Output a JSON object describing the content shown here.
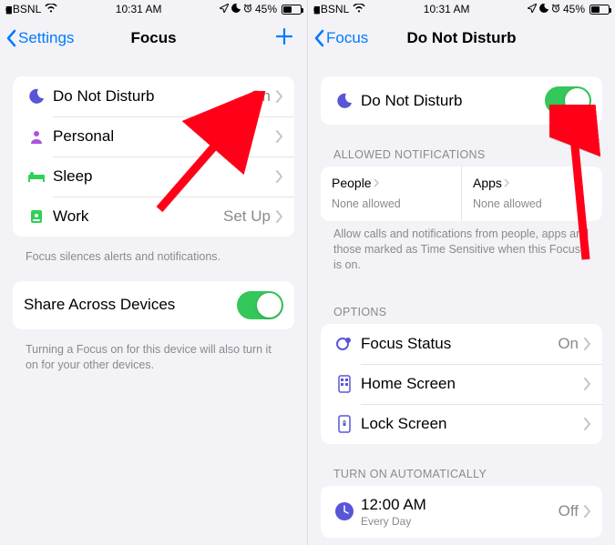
{
  "status": {
    "carrier": "BSNL",
    "time": "10:31 AM",
    "battery_pct": "45%"
  },
  "left": {
    "back": "Settings",
    "title": "Focus",
    "rows": [
      {
        "label": "Do Not Disturb",
        "value": "On"
      },
      {
        "label": "Personal",
        "value": ""
      },
      {
        "label": "Sleep",
        "value": ""
      },
      {
        "label": "Work",
        "value": "Set Up"
      }
    ],
    "footer1": "Focus silences alerts and notifications.",
    "share_label": "Share Across Devices",
    "footer2": "Turning a Focus on for this device will also turn it on for your other devices."
  },
  "right": {
    "back": "Focus",
    "title": "Do Not Disturb",
    "dnd_label": "Do Not Disturb",
    "allowed_header": "ALLOWED NOTIFICATIONS",
    "people_label": "People",
    "people_sub": "None allowed",
    "apps_label": "Apps",
    "apps_sub": "None allowed",
    "allowed_footer": "Allow calls and notifications from people, apps and those marked as Time Sensitive when this Focus is on.",
    "options_header": "OPTIONS",
    "options": [
      {
        "label": "Focus Status",
        "value": "On"
      },
      {
        "label": "Home Screen",
        "value": ""
      },
      {
        "label": "Lock Screen",
        "value": ""
      }
    ],
    "auto_header": "TURN ON AUTOMATICALLY",
    "auto_time": "12:00 AM",
    "auto_sub": "Every Day",
    "auto_value": "Off"
  }
}
